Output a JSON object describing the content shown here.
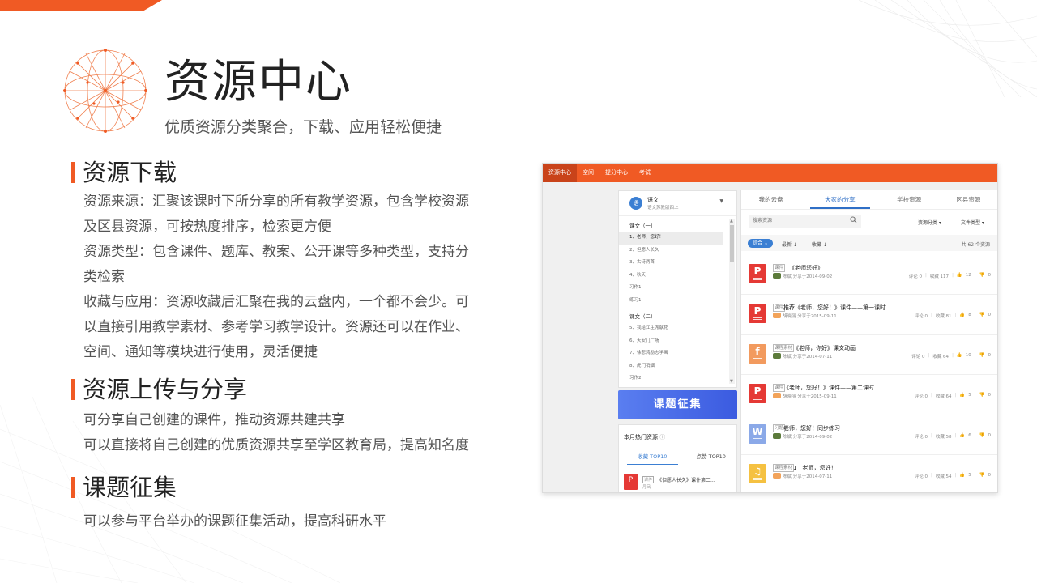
{
  "header": {
    "title": "资源中心",
    "subtitle": "优质资源分类聚合，下载、应用轻松便捷"
  },
  "sections": [
    {
      "heading": "资源下载",
      "lines": [
        "资源来源：汇聚该课时下所分享的所有教学资源，包含学校资源",
        "及区县资源，可按热度排序，检索更方便",
        "资源类型：包含课件、题库、教案、公开课等多种类型，支持分",
        "类检索",
        "收藏与应用：资源收藏后汇聚在我的云盘内，一个都不会少。可",
        "以直接引用教学素材、参考学习教学设计。资源还可以在作业、",
        "空间、通知等模块进行使用，灵活便捷"
      ]
    },
    {
      "heading": "资源上传与分享",
      "lines": [
        "可分享自己创建的课件，推动资源共建共享",
        "可以直接将自己创建的优质资源共享至学区教育局，提高知名度"
      ]
    },
    {
      "heading": "课题征集",
      "lines": [
        "可以参与平台举办的课题征集活动，提高科研水平"
      ]
    }
  ],
  "screenshot": {
    "nav": [
      "资源中心",
      "空间",
      "提分中心",
      "考试"
    ],
    "course": {
      "avatar": "语",
      "name": "语文",
      "meta": "语文苏教版四上",
      "groups": [
        {
          "label": "课文（一）",
          "items": [
            "1、老师，您好！",
            "2、但愿人长久",
            "3、古诗两首",
            "4、秋天",
            "习作1",
            "练习1"
          ]
        },
        {
          "label": "课文（二）",
          "items": [
            "5、我给江主席献花",
            "6、天安门广场",
            "7、徐悲鸿励志学画",
            "8、虎门销烟",
            "习作2"
          ]
        }
      ]
    },
    "banner": "课题征集",
    "hot": {
      "title": "本月热门资源",
      "tabs": [
        "收藏 TOP10",
        "点赞 TOP10"
      ],
      "item": {
        "icon": "P",
        "badge": "课件",
        "title": "《但愿人长久》课件第二...",
        "author": "丹凤"
      }
    },
    "tabs": [
      "我的云盘",
      "大家的分享",
      "学校资源",
      "区县资源"
    ],
    "search_placeholder": "搜索资源",
    "filters": [
      "资源分类 ▾",
      "文件类型 ▾"
    ],
    "sort": {
      "active": "综合 ↓",
      "latest": "最新 ↓",
      "fav": "收藏 ↓"
    },
    "count": "共 62 个资源",
    "rows": [
      {
        "icon": "P",
        "color": "#e53935",
        "badge": "课件",
        "title": "《老师您好》",
        "author": "陈斌 分享于2014-09-02",
        "comments": "评论 0",
        "favs": "收藏 117",
        "likes": "12",
        "dislikes": "0"
      },
      {
        "icon": "P",
        "color": "#e53935",
        "badge": "课件",
        "title": "推荐《老师，您好！》课件——第一课时",
        "author": "胡晓丽 分享于2015-09-11",
        "comments": "评论 0",
        "favs": "收藏 81",
        "likes": "8",
        "dislikes": "0"
      },
      {
        "icon": "f",
        "color": "#f29a5e",
        "badge": "课程素材",
        "title": "《老师，你好》课文动画",
        "author": "陈斌 分享于2014-07-11",
        "comments": "评论 0",
        "favs": "收藏 64",
        "likes": "10",
        "dislikes": "0"
      },
      {
        "icon": "P",
        "color": "#e53935",
        "badge": "课件",
        "title": "《老师，您好！》课件——第二课时",
        "author": "胡晓丽 分享于2015-09-11",
        "comments": "评论 0",
        "favs": "收藏 64",
        "likes": "5",
        "dislikes": "0"
      },
      {
        "icon": "W",
        "color": "#8ba9e8",
        "badge": "习题",
        "title": "老师，您好！同步练习",
        "author": "陈斌 分享于2014-09-02",
        "comments": "评论 0",
        "favs": "收藏 58",
        "likes": "6",
        "dislikes": "0"
      },
      {
        "icon": "♫",
        "color": "#f5c141",
        "badge": "课程素材",
        "title": "1　老师，您好！",
        "author": "陈斌 分享于2014-07-11",
        "comments": "评论 0",
        "favs": "收藏 54",
        "likes": "5",
        "dislikes": "0"
      }
    ],
    "colors": {
      "accent": "#f05a24",
      "primary_blue": "#3b7fd3"
    },
    "icons": [
      "search-icon",
      "thumb-up-icon",
      "thumb-down-icon",
      "help-icon",
      "caret-down-icon"
    ]
  }
}
